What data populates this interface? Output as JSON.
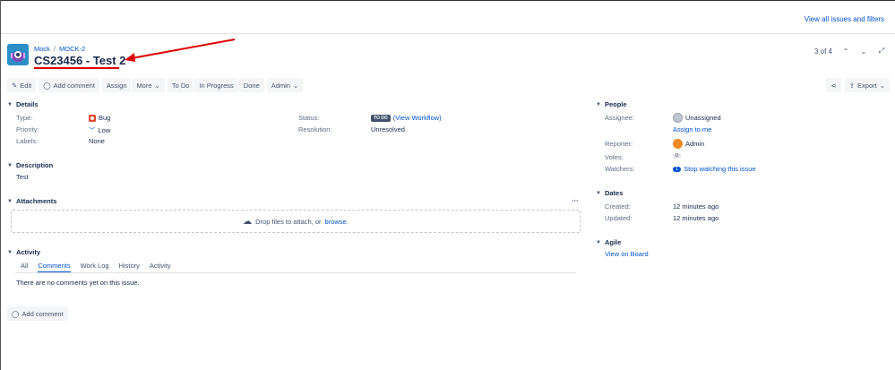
{
  "topbar": {
    "view_all": "View all issues and filters"
  },
  "breadcrumb": {
    "project": "Mock",
    "issue_key": "MOCK-2"
  },
  "issue": {
    "title": "CS23456 - Test 2"
  },
  "pager": {
    "position": "3 of 4"
  },
  "toolbar": {
    "edit": "Edit",
    "add_comment": "Add comment",
    "assign": "Assign",
    "more": "More",
    "to_do": "To Do",
    "in_progress": "In Progress",
    "done": "Done",
    "admin": "Admin",
    "export": "Export"
  },
  "details": {
    "heading": "Details",
    "type_label": "Type:",
    "type_value": "Bug",
    "priority_label": "Priority:",
    "priority_value": "Low",
    "labels_label": "Labels:",
    "labels_value": "None",
    "status_label": "Status:",
    "status_badge": "TO DO",
    "status_link": "(View Workflow)",
    "resolution_label": "Resolution:",
    "resolution_value": "Unresolved"
  },
  "description": {
    "heading": "Description",
    "text": "Test"
  },
  "attachments": {
    "heading": "Attachments",
    "drop_text": "Drop files to attach, or",
    "browse": "browse."
  },
  "activity": {
    "heading": "Activity",
    "tabs": [
      "All",
      "Comments",
      "Work Log",
      "History",
      "Activity"
    ],
    "empty": "There are no comments yet on this issue.",
    "add_comment": "Add comment"
  },
  "people": {
    "heading": "People",
    "assignee_label": "Assignee:",
    "assignee_value": "Unassigned",
    "assign_to_me": "Assign to me",
    "reporter_label": "Reporter:",
    "reporter_value": "Admin",
    "votes_label": "Votes:",
    "votes_count": "0",
    "watchers_label": "Watchers:",
    "watchers_count": "1",
    "watchers_link": "Stop watching this issue"
  },
  "dates": {
    "heading": "Dates",
    "created_label": "Created:",
    "created_value": "12 minutes ago",
    "updated_label": "Updated:",
    "updated_value": "12 minutes ago"
  },
  "agile": {
    "heading": "Agile",
    "view_on_board": "View on Board"
  },
  "colors": {
    "link": "#0052cc",
    "annotation": "#e00000",
    "bug": "#e5493a"
  }
}
